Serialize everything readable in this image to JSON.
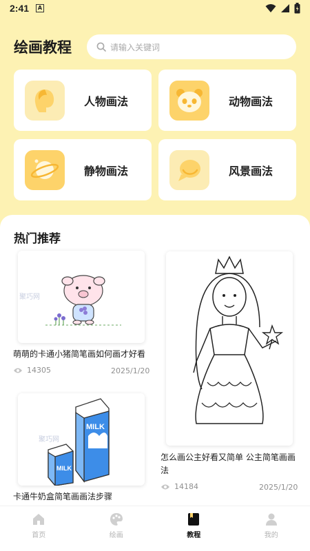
{
  "status_bar": {
    "time": "2:41",
    "indicator": "A"
  },
  "header": {
    "title": "绘画教程",
    "search_placeholder": "请输入关键词"
  },
  "categories": [
    {
      "label": "人物画法",
      "icon": "person-head-icon",
      "bg": "#fcecb4"
    },
    {
      "label": "动物画法",
      "icon": "panda-icon",
      "bg": "#fdd36a"
    },
    {
      "label": "静物画法",
      "icon": "planet-icon",
      "bg": "#fdd36a"
    },
    {
      "label": "风景画法",
      "icon": "chat-bubble-icon",
      "bg": "#fcecb4"
    }
  ],
  "section_title": "热门推荐",
  "recommendations": [
    {
      "title": "萌萌的卡通小猪简笔画如何画才好看",
      "views": "14305",
      "date": "2025/1/20",
      "watermark": "聚巧网"
    },
    {
      "title": "怎么画公主好看又简单 公主简笔画画法",
      "views": "14184",
      "date": "2025/1/20"
    },
    {
      "title": "卡通牛奶盒简笔画画法步骤",
      "watermark": "聚巧网",
      "carton_text": "MILK"
    }
  ],
  "tabs": [
    {
      "label": "首页",
      "icon": "home-icon"
    },
    {
      "label": "绘画",
      "icon": "palette-icon"
    },
    {
      "label": "教程",
      "icon": "book-icon",
      "active": true
    },
    {
      "label": "我的",
      "icon": "user-icon"
    }
  ],
  "colors": {
    "background": "#fdf2b3",
    "accent": "#fdd36a",
    "card": "#ffffff"
  }
}
